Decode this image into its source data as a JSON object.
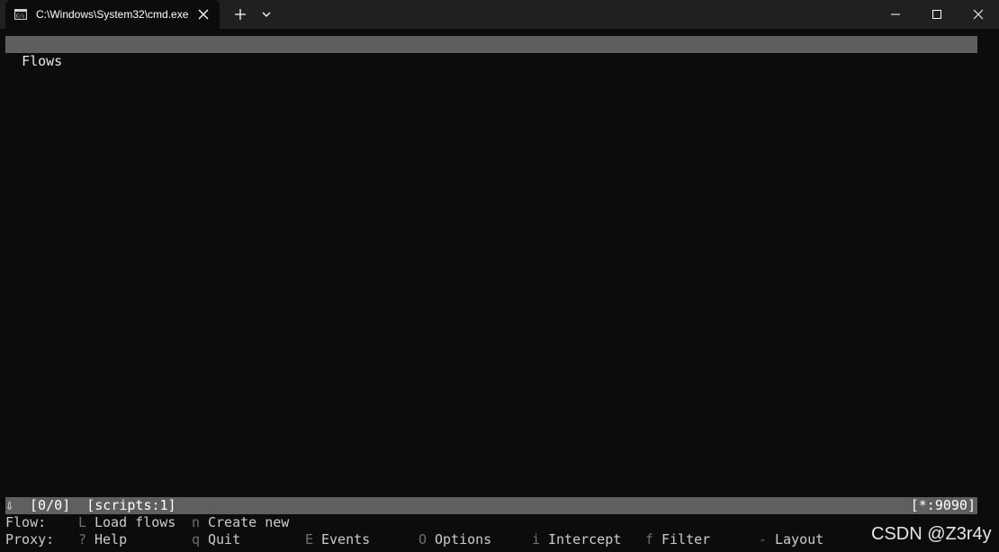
{
  "window": {
    "tab_title": "C:\\Windows\\System32\\cmd.exe",
    "tab_icon": "cmd-icon",
    "new_tab_icon": "plus-icon",
    "dropdown_icon": "chevron-down-icon",
    "controls": [
      "minimize-icon",
      "maximize-icon",
      "close-icon"
    ]
  },
  "terminal": {
    "header": "Flows",
    "status": {
      "left_icon": "⇩",
      "flow_count": "[0/0]",
      "scripts": "[scripts:1]",
      "listen": "[*:9090]"
    },
    "keybindings": {
      "flow_label": "Flow:",
      "proxy_label": "Proxy:",
      "flow": [
        {
          "key": "L",
          "action": "Load flows"
        },
        {
          "key": "n",
          "action": "Create new"
        }
      ],
      "proxy": [
        {
          "key": "?",
          "action": "Help"
        },
        {
          "key": "q",
          "action": "Quit"
        },
        {
          "key": "E",
          "action": "Events"
        },
        {
          "key": "O",
          "action": "Options"
        },
        {
          "key": "i",
          "action": "Intercept"
        },
        {
          "key": "f",
          "action": "Filter"
        },
        {
          "key": "-",
          "action": "Layout"
        }
      ]
    }
  },
  "watermark": "CSDN @Z3r4y"
}
